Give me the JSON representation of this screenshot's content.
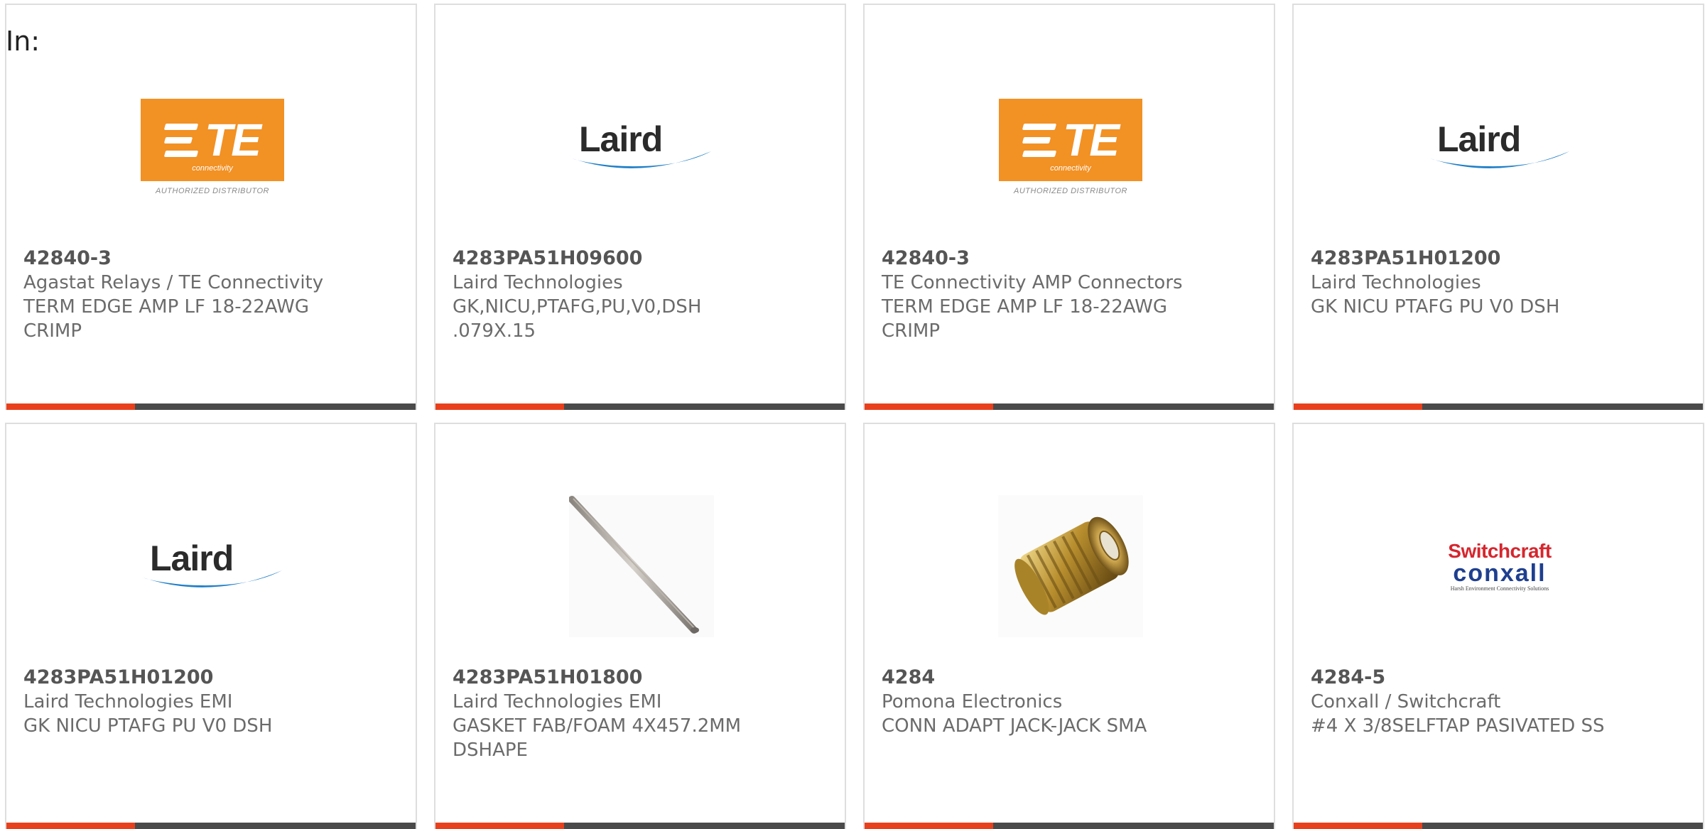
{
  "header": {
    "in_label": "In:"
  },
  "logo_text": {
    "te": "TE",
    "te_sub": "connectivity",
    "te_distributor": "AUTHORIZED DISTRIBUTOR",
    "laird": "Laird",
    "switchcraft": "Switchcraft",
    "conxall": "conxall",
    "conxall_tagline": "Harsh Environment Connectivity Solutions"
  },
  "colors": {
    "accent": "#e8401c",
    "bar": "#4a4a4a",
    "te_orange": "#f29124",
    "laird_blue": "#1f7fc8"
  },
  "products": [
    {
      "part_number": "42840-3",
      "manufacturer": "Agastat Relays / TE Connectivity",
      "description": "TERM EDGE AMP LF 18-22AWG\nCRIMP",
      "image": "te-connectivity-logo"
    },
    {
      "part_number": "4283PA51H09600",
      "manufacturer": "Laird Technologies",
      "description": "GK,NICU,PTAFG,PU,V0,DSH\n.079X.15",
      "image": "laird-logo"
    },
    {
      "part_number": "42840-3",
      "manufacturer": "TE Connectivity AMP Connectors",
      "description": "TERM EDGE AMP LF 18-22AWG\nCRIMP",
      "image": "te-connectivity-logo"
    },
    {
      "part_number": "4283PA51H01200",
      "manufacturer": "Laird Technologies",
      "description": "GK NICU PTAFG PU V0 DSH",
      "image": "laird-logo"
    },
    {
      "part_number": "4283PA51H01200",
      "manufacturer": "Laird Technologies EMI",
      "description": "GK NICU PTAFG PU V0 DSH",
      "image": "laird-logo"
    },
    {
      "part_number": "4283PA51H01800",
      "manufacturer": "Laird Technologies EMI",
      "description": "GASKET FAB/FOAM 4X457.2MM\nDSHAPE",
      "image": "gasket-photo"
    },
    {
      "part_number": "4284",
      "manufacturer": "Pomona Electronics",
      "description": "CONN ADAPT JACK-JACK SMA",
      "image": "sma-adapter-photo"
    },
    {
      "part_number": "4284-5",
      "manufacturer": "Conxall / Switchcraft",
      "description": "#4 X 3/8SELFTAP PASIVATED SS",
      "image": "switchcraft-conxall-logo"
    }
  ]
}
